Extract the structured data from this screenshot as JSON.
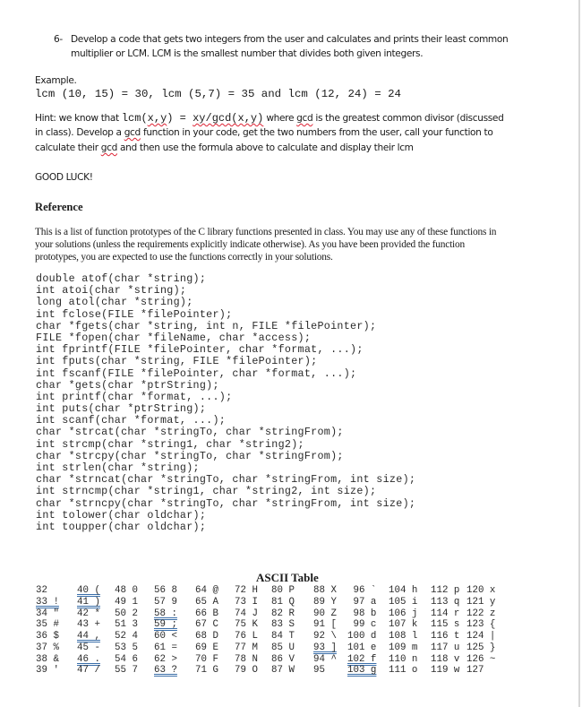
{
  "question": {
    "number": "6-",
    "line1": "Develop a code that gets two integers from the user and calculates and prints their least common",
    "line2": "multiplier or LCM. LCM is the smallest number that divides both given integers."
  },
  "example": {
    "label": "Example.",
    "code": "lcm (10, 15) = 30, lcm (5,7) = 35 and lcm (12, 24) = 24"
  },
  "hint": {
    "l1_a": "Hint: we know that ",
    "l1_code1": "lcm(x,y)",
    "l1_eq": " = ",
    "l1_code2": "xy/gcd(x,y)",
    "l1_b": " where ",
    "l1_gcd": "gcd",
    "l1_c": " is the greatest common divisor (discussed",
    "l2_a": "in class). Develop a ",
    "l2_gcd": "gcd",
    "l2_b": " function in your code, get the two numbers from the user, call your function to",
    "l3_a": "calculate their ",
    "l3_gcd": "gcd",
    "l3_b": " and then use the formula above to calculate and display their lcm"
  },
  "closing": "GOOD LUCK!",
  "reference": {
    "heading": "Reference",
    "para_line1": "This is a list of function prototypes of the C library functions presented in class.  You may use any of these functions in",
    "para_line2": "your solutions (unless the requirements explicitly indicate otherwise).  As you have been provided the function",
    "para_line3": "prototypes, you are expected to use the functions correctly in your solutions.",
    "prototypes": [
      "double atof(char *string);",
      "int atoi(char *string);",
      "long atol(char *string);",
      "int fclose(FILE *filePointer);",
      "char *fgets(char *string, int n, FILE *filePointer);",
      "FILE *fopen(char *fileName, char *access);",
      "int fprintf(FILE *filePointer, char *format, ...);",
      "int fputs(char *string, FILE *filePointer);",
      "int fscanf(FILE *filePointer, char *format, ...);",
      "char *gets(char *ptrString);",
      "int printf(char *format, ...);",
      "int puts(char *ptrString);",
      "int scanf(char *format, ...);",
      "char *strcat(char *stringTo, char *stringFrom);",
      "int strcmp(char *string1, char *string2);",
      "char *strcpy(char *stringTo, char *stringFrom);",
      "int strlen(char *string);",
      "char *strncat(char *stringTo, char *stringFrom, int size);",
      "int strncmp(char *string1, char *string2, int size);",
      "char *strncpy(char *stringTo, char *stringFrom, int size);",
      "int tolower(char oldchar);",
      "int toupper(char oldchar);"
    ]
  },
  "ascii_table": {
    "title": "ASCII Table",
    "columns": [
      [
        "32  ",
        "33 !",
        "34 \"",
        "35 #",
        "36 $",
        "37 %",
        "38 &",
        "39 '"
      ],
      [
        "40 (",
        "41 )",
        "42 *",
        "43 +",
        "44 ,",
        "45 -",
        "46 .",
        "47 /"
      ],
      [
        "48 0",
        "49 1",
        "50 2",
        "51 3",
        "52 4",
        "53 5",
        "54 6",
        "55 7"
      ],
      [
        "56 8",
        "57 9",
        "58 :",
        "59 ;",
        "60 <",
        "61 =",
        "62 >",
        "63 ?"
      ],
      [
        "64 @",
        "65 A",
        "66 B",
        "67 C",
        "68 D",
        "69 E",
        "70 F",
        "71 G"
      ],
      [
        "72 H",
        "73 I",
        "74 J",
        "75 K",
        "76 L",
        "77 M",
        "78 N",
        "79 O"
      ],
      [
        "80 P",
        "81 Q",
        "82 R",
        "83 S",
        "84 T",
        "85 U",
        "86 V",
        "87 W"
      ],
      [
        "88 X",
        "89 Y",
        "90 Z",
        "91 [",
        "92 \\",
        "93 ]",
        "94 ^",
        "95  "
      ],
      [
        " 96 `",
        " 97 a",
        " 98 b",
        " 99 c",
        "100 d",
        "101 e",
        "102 f",
        "103 g"
      ],
      [
        "104 h",
        "105 i",
        "106 j",
        "107 k",
        "108 l",
        "109 m",
        "110 n",
        "111 o"
      ],
      [
        "112 p",
        "113 q",
        "114 r",
        "115 s",
        "116 t",
        "117 u",
        "118 v",
        "119 w"
      ],
      [
        "120 x",
        "121 y",
        "122 z",
        "123 {",
        "124 |",
        "125 }",
        "126 ~",
        "127  "
      ]
    ]
  }
}
